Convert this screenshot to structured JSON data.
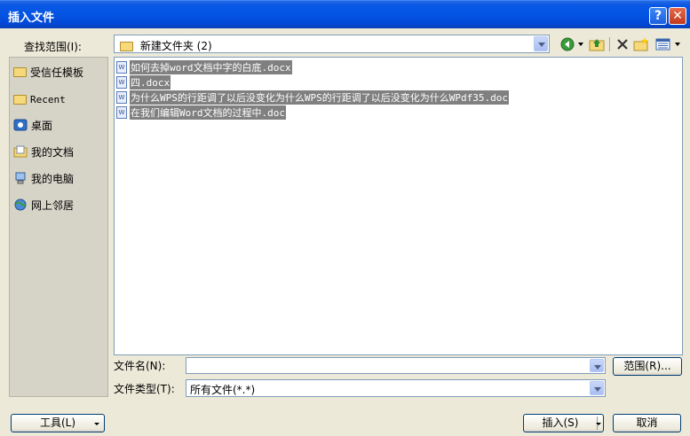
{
  "window": {
    "title": "插入文件",
    "help_glyph": "?",
    "close_glyph": "✕"
  },
  "lookin": {
    "label": "查找范围(I):",
    "value": "新建文件夹 (2)"
  },
  "places": [
    {
      "label": "受信任模板",
      "icon": "folder-icon"
    },
    {
      "label": "Recent",
      "icon": "folder-icon"
    },
    {
      "label": "桌面",
      "icon": "desktop-icon"
    },
    {
      "label": "我的文档",
      "icon": "documents-icon"
    },
    {
      "label": "我的电脑",
      "icon": "computer-icon"
    },
    {
      "label": "网上邻居",
      "icon": "network-icon"
    }
  ],
  "files": [
    {
      "name": "如何去掉word文档中字的白底.docx"
    },
    {
      "name": "四.docx"
    },
    {
      "name": "为什么WPS的行距调了以后没变化为什么WPS的行距调了以后没变化为什么WPdf35.doc"
    },
    {
      "name": "在我们编辑Word文档的过程中.doc"
    }
  ],
  "filename": {
    "label": "文件名(N):",
    "value": ""
  },
  "filetype": {
    "label": "文件类型(T):",
    "value": "所有文件(*.*)"
  },
  "buttons": {
    "range": "范围(R)...",
    "tools": "工具(L)",
    "insert": "插入(S)",
    "cancel": "取消"
  },
  "colors": {
    "titlebar": "#0454e3",
    "selection": "#808080",
    "dialog_bg": "#ece9d8"
  }
}
